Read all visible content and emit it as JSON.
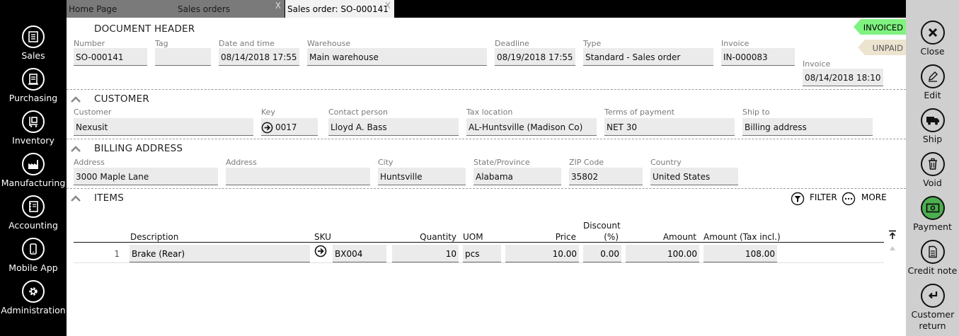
{
  "nav": [
    {
      "label": "Sales",
      "icon": "sales-icon"
    },
    {
      "label": "Purchasing",
      "icon": "purchasing-icon"
    },
    {
      "label": "Inventory",
      "icon": "inventory-icon"
    },
    {
      "label": "Manufacturing",
      "icon": "manufacturing-icon"
    },
    {
      "label": "Accounting",
      "icon": "accounting-icon"
    },
    {
      "label": "Mobile App",
      "icon": "mobile-app-icon"
    },
    {
      "label": "Administration",
      "icon": "gear-icon"
    }
  ],
  "tabs": [
    {
      "label": "Home Page",
      "close": ""
    },
    {
      "label": "Sales orders",
      "close": "X"
    },
    {
      "label": "Sales order: SO-000141",
      "close": "X"
    }
  ],
  "header": {
    "title": "DOCUMENT HEADER",
    "number": {
      "label": "Number",
      "value": "SO-000141"
    },
    "tag": {
      "label": "Tag",
      "value": ""
    },
    "datetime": {
      "label": "Date and time",
      "value": "08/14/2018 17:55"
    },
    "warehouse": {
      "label": "Warehouse",
      "value": "Main warehouse"
    },
    "deadline": {
      "label": "Deadline",
      "value": "08/19/2018 17:55"
    },
    "type": {
      "label": "Type",
      "value": "Standard - Sales order"
    },
    "invoice": {
      "label": "Invoice",
      "value": "IN-000083"
    },
    "invoice_date": {
      "label": "Invoice",
      "value": "08/14/2018 18:10"
    }
  },
  "status": {
    "invoiced": "INVOICED",
    "unpaid": "UNPAID",
    "invoiced_color": "#7ff27f",
    "unpaid_color": "#ece4cf"
  },
  "customer": {
    "title": "CUSTOMER",
    "customer": {
      "label": "Customer",
      "value": "Nexusit"
    },
    "key": {
      "label": "Key",
      "value": "0017"
    },
    "contact": {
      "label": "Contact person",
      "value": "Lloyd A. Bass"
    },
    "taxloc": {
      "label": "Tax location",
      "value": "AL-Huntsville (Madison Co)"
    },
    "terms": {
      "label": "Terms of payment",
      "value": "NET 30"
    },
    "shipto": {
      "label": "Ship to",
      "value": "Billing address"
    }
  },
  "billing": {
    "title": "BILLING ADDRESS",
    "address1": {
      "label": "Address",
      "value": "3000 Maple Lane"
    },
    "address2": {
      "label": "Address",
      "value": ""
    },
    "city": {
      "label": "City",
      "value": "Huntsville"
    },
    "state": {
      "label": "State/Province",
      "value": "Alabama"
    },
    "zip": {
      "label": "ZIP Code",
      "value": "35802"
    },
    "country": {
      "label": "Country",
      "value": "United States"
    }
  },
  "items": {
    "title": "ITEMS",
    "filter": "FILTER",
    "more": "MORE",
    "columns": {
      "description": "Description",
      "sku": "SKU",
      "quantity": "Quantity",
      "uom": "UOM",
      "price": "Price",
      "discount1": "Discount",
      "discount2": "(%)",
      "amount": "Amount",
      "amount_tax": "Amount (Tax incl.)"
    },
    "rows": [
      {
        "n": "1",
        "description": "Brake (Rear)",
        "sku": "BX004",
        "quantity": "10",
        "uom": "pcs",
        "price": "10.00",
        "discount": "0.00",
        "amount": "100.00",
        "amount_tax": "108.00"
      }
    ]
  },
  "actions": [
    {
      "label": "Close",
      "icon": "close-icon"
    },
    {
      "label": "Edit",
      "icon": "edit-icon"
    },
    {
      "label": "Ship",
      "icon": "truck-icon"
    },
    {
      "label": "Void",
      "icon": "trash-icon"
    },
    {
      "label": "Payment",
      "icon": "payment-icon"
    },
    {
      "label": "Credit note",
      "icon": "credit-note-icon"
    },
    {
      "label": "Customer return",
      "icon": "return-icon"
    }
  ],
  "colors": {
    "payment_active": "#4caf50",
    "rightbar_bg": "#cfcfcf",
    "field_bg": "#ebebeb"
  }
}
